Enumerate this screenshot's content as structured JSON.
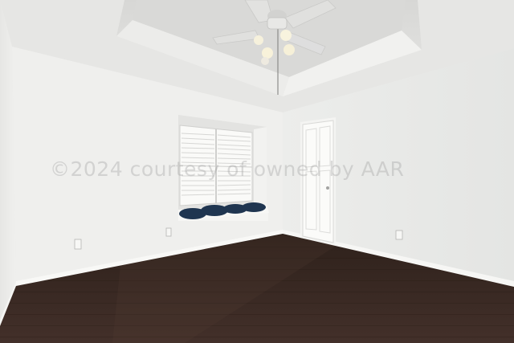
{
  "photo": {
    "subject": "empty bedroom",
    "watermark_text": "©2024 courtesy of owned by AAR",
    "colors": {
      "wall": "#ededeb",
      "ceiling": "#e4e4e2",
      "floor": "#3a2a22",
      "trim": "#f7f7f5",
      "cushions": "#1f3550"
    },
    "elements": [
      "tray-ceiling",
      "ceiling-fan",
      "window-seat",
      "plantation-shutters",
      "door",
      "wall-outlets",
      "baseboards",
      "hardwood-floor"
    ]
  }
}
